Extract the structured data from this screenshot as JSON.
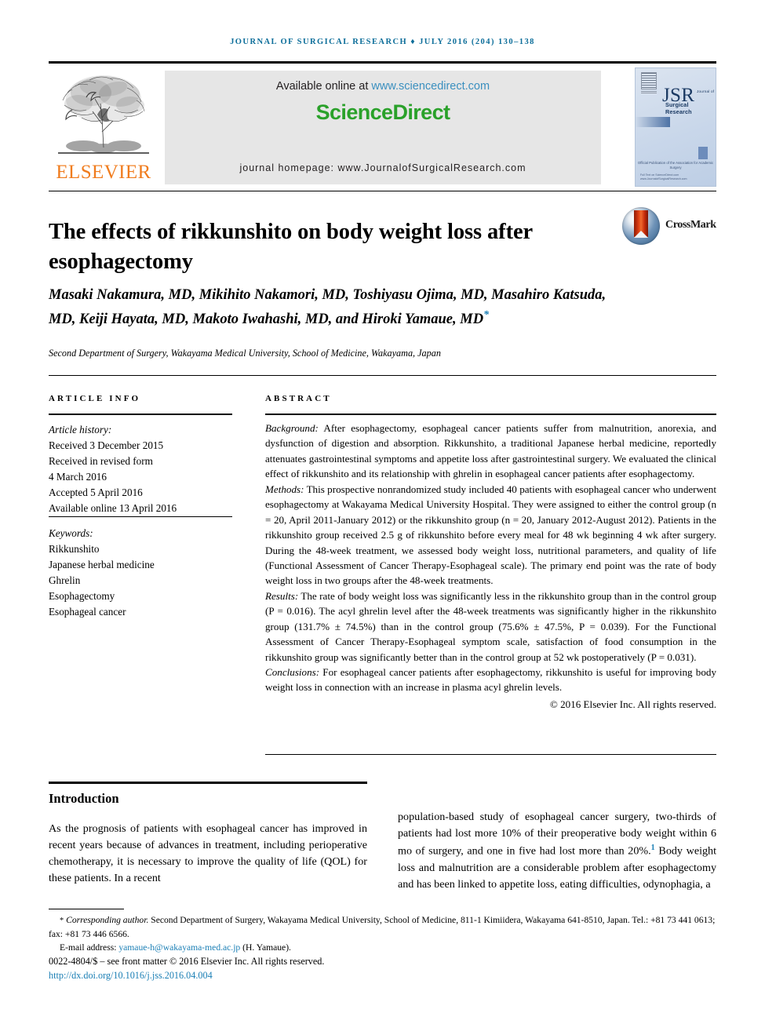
{
  "running_head": "JOURNAL OF SURGICAL RESEARCH ♦ JULY 2016 (204) 130–138",
  "masthead": {
    "publisher_name": "ELSEVIER",
    "available_online_prefix": "Available online at ",
    "sciencedirect_url": "www.sciencedirect.com",
    "sciencedirect_logo": "ScienceDirect",
    "journal_homepage": "journal homepage: www.JournalofSurgicalResearch.com",
    "cover": {
      "title": "JSR",
      "sub_journal_of": "Journal of",
      "sub_name": "Surgical Research",
      "official_line": "Official Publication of the\nAssociation for Academic Surgery",
      "footer_line": "Full Text on ScienceDirect.com\nwww.JournalofSurgicalResearch.com"
    }
  },
  "article": {
    "title": "The effects of rikkunshito on body weight loss after esophagectomy",
    "crossmark_label": "CrossMark",
    "authors_html": "Masaki Nakamura, MD, Mikihito Nakamori, MD, Toshiyasu Ojima, MD, Masahiro Katsuda, MD, Keiji Hayata, MD, Makoto Iwahashi, MD, and Hiroki Yamaue, MD",
    "corresponding_marker": "*",
    "affiliation": "Second Department of Surgery, Wakayama Medical University, School of Medicine, Wakayama, Japan"
  },
  "sections": {
    "article_info_heading": "ARTICLE INFO",
    "abstract_heading": "ABSTRACT",
    "introduction_heading": "Introduction"
  },
  "article_info": {
    "history_label": "Article history:",
    "history": [
      "Received 3 December 2015",
      "Received in revised form",
      "4 March 2016",
      "Accepted 5 April 2016",
      "Available online 13 April 2016"
    ],
    "keywords_label": "Keywords:",
    "keywords": [
      "Rikkunshito",
      "Japanese herbal medicine",
      "Ghrelin",
      "Esophagectomy",
      "Esophageal cancer"
    ]
  },
  "abstract": {
    "background_label": "Background:",
    "background_text": " After esophagectomy, esophageal cancer patients suffer from malnutrition, anorexia, and dysfunction of digestion and absorption. Rikkunshito, a traditional Japanese herbal medicine, reportedly attenuates gastrointestinal symptoms and appetite loss after gastrointestinal surgery. We evaluated the clinical effect of rikkunshito and its relationship with ghrelin in esophageal cancer patients after esophagectomy.",
    "methods_label": "Methods:",
    "methods_text": " This prospective nonrandomized study included 40 patients with esophageal cancer who underwent esophagectomy at Wakayama Medical University Hospital. They were assigned to either the control group (n = 20, April 2011-January 2012) or the rikkunshito group (n = 20, January 2012-August 2012). Patients in the rikkunshito group received 2.5 g of rikkunshito before every meal for 48 wk beginning 4 wk after surgery. During the 48-week treatment, we assessed body weight loss, nutritional parameters, and quality of life (Functional Assessment of Cancer Therapy-Esophageal scale). The primary end point was the rate of body weight loss in two groups after the 48-week treatments.",
    "results_label": "Results:",
    "results_text": " The rate of body weight loss was significantly less in the rikkunshito group than in the control group (P = 0.016). The acyl ghrelin level after the 48-week treatments was significantly higher in the rikkunshito group (131.7% ± 74.5%) than in the control group (75.6% ± 47.5%, P = 0.039). For the Functional Assessment of Cancer Therapy-Esophageal symptom scale, satisfaction of food consumption in the rikkunshito group was significantly better than in the control group at 52 wk postoperatively (P = 0.031).",
    "conclusions_label": "Conclusions:",
    "conclusions_text": " For esophageal cancer patients after esophagectomy, rikkunshito is useful for improving body weight loss in connection with an increase in plasma acyl ghrelin levels.",
    "copyright": "© 2016 Elsevier Inc. All rights reserved."
  },
  "body": {
    "intro_col_left": "As the prognosis of patients with esophageal cancer has improved in recent years because of advances in treatment, including perioperative chemotherapy, it is necessary to improve the quality of life (QOL) for these patients. In a recent",
    "intro_col_right_a": "population-based study of esophageal cancer surgery, two-thirds of patients had lost more 10% of their preoperative body weight within 6 mo of surgery, and one in five had lost more than 20%.",
    "intro_col_right_ref": "1",
    "intro_col_right_b": " Body weight loss and malnutrition are a considerable problem after esophagectomy and has been linked to appetite loss, eating difficulties, odynophagia, a"
  },
  "footnote": {
    "corresponding_marker": "*",
    "corresponding_label": "Corresponding author.",
    "corresponding_address": " Second Department of Surgery, Wakayama Medical University, School of Medicine, 811-1 Kimiidera, Wakayama 641-8510, Japan. Tel.: +81 73 441 0613; fax: +81 73 446 6566.",
    "email_label": "E-mail address: ",
    "email": "yamaue-h@wakayama-med.ac.jp",
    "email_suffix": " (H. Yamaue).",
    "issn_line": "0022-4804/$ – see front matter © 2016 Elsevier Inc. All rights reserved.",
    "doi": "http://dx.doi.org/10.1016/j.jss.2016.04.004"
  },
  "colors": {
    "accent_blue": "#1b7fb5",
    "running_head_blue": "#0d6e9a",
    "elsevier_orange": "#f07c1e",
    "sciencedirect_green": "#2aa12a",
    "banner_gray": "#e6e6e6",
    "cover_blue": "#c9d7ea"
  }
}
